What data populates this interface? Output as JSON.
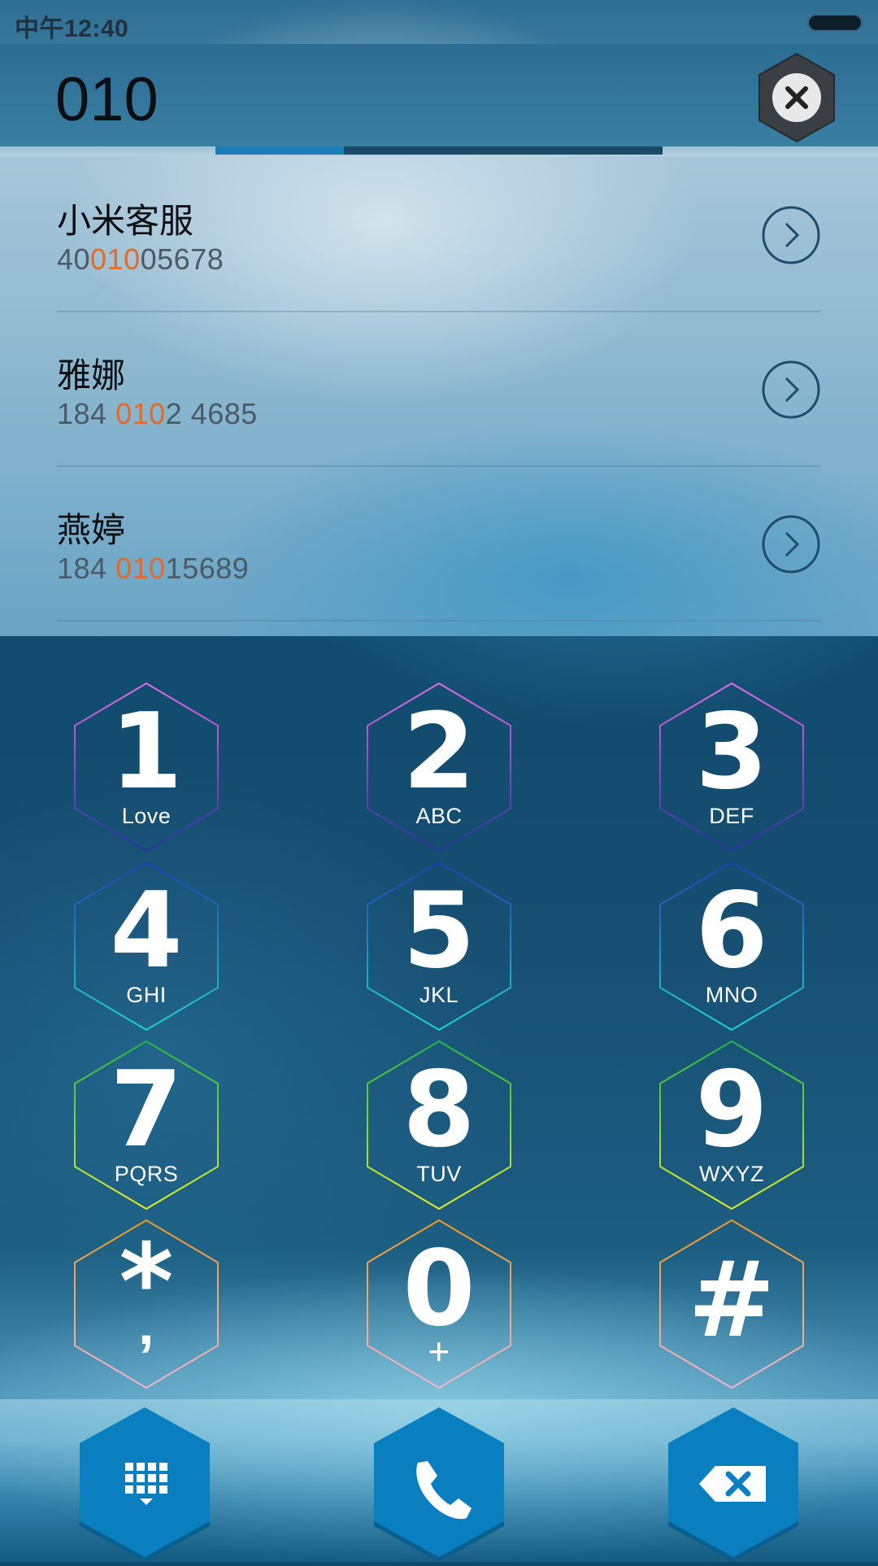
{
  "status_bar": {
    "time": "中午12:40"
  },
  "header": {
    "dialed": "010"
  },
  "results": [
    {
      "name": "小米客服",
      "num_pre": "40",
      "num_hl": "010",
      "num_post": "05678"
    },
    {
      "name": "雅娜",
      "num_pre": "184 ",
      "num_hl": "010",
      "num_post": "2 4685"
    },
    {
      "name": "燕婷",
      "num_pre": "184 ",
      "num_hl": "010",
      "num_post": "15689"
    }
  ],
  "keypad": [
    {
      "digit": "1",
      "letters": "Love"
    },
    {
      "digit": "2",
      "letters": "ABC"
    },
    {
      "digit": "3",
      "letters": "DEF"
    },
    {
      "digit": "4",
      "letters": "GHI"
    },
    {
      "digit": "5",
      "letters": "JKL"
    },
    {
      "digit": "6",
      "letters": "MNO"
    },
    {
      "digit": "7",
      "letters": "PQRS"
    },
    {
      "digit": "8",
      "letters": "TUV"
    },
    {
      "digit": "9",
      "letters": "WXYZ"
    },
    {
      "digit": "*",
      "letters": ","
    },
    {
      "digit": "0",
      "letters": "+"
    },
    {
      "digit": "#",
      "letters": ""
    }
  ],
  "colors": {
    "highlight": "#e46a2c",
    "action_blue": "#0a7fbf",
    "row1_hex": [
      "#e46be6",
      "#2a2fa8"
    ],
    "row2_hex": [
      "#1f3fb8",
      "#1fd6d0"
    ],
    "row3_hex": [
      "#21b84a",
      "#e8ef24"
    ],
    "row4_hex": [
      "#f09a1e",
      "#f4b4cf"
    ]
  },
  "icons": {
    "clear": "close-icon",
    "dialpad": "dialpad-icon",
    "call": "phone-icon",
    "backspace": "backspace-icon",
    "result_action": "chevron-right-icon"
  }
}
